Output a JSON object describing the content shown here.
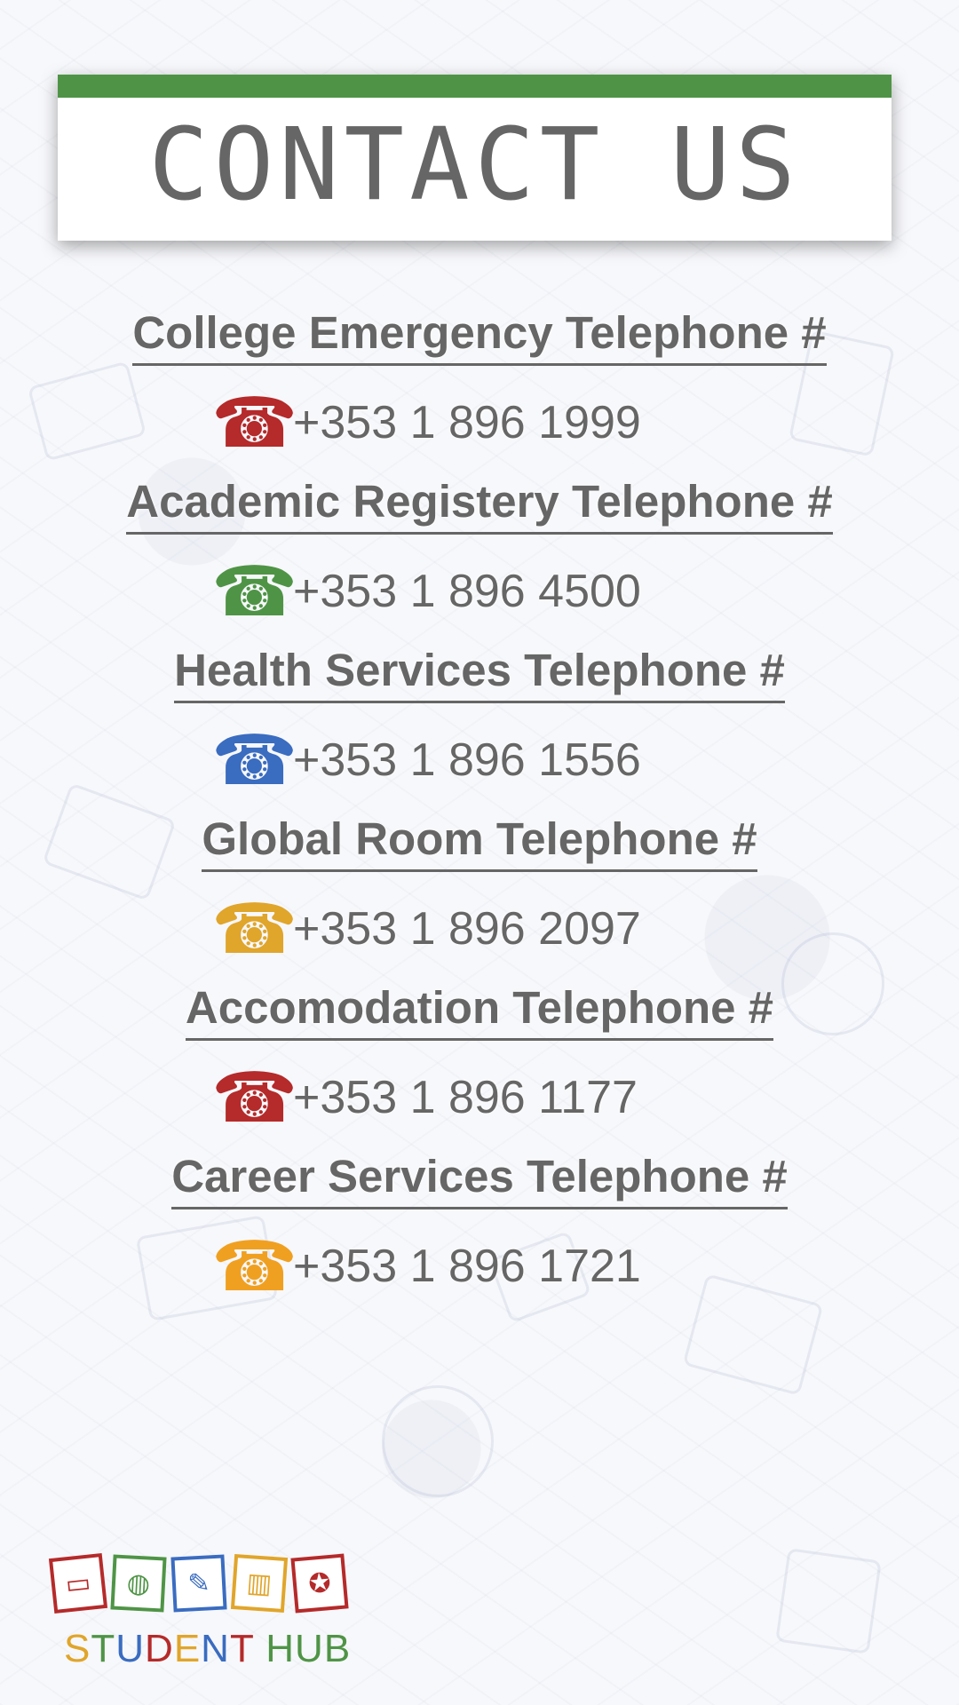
{
  "header": {
    "title": "CONTACT US",
    "accent": "#4f9446"
  },
  "contacts": [
    {
      "title": "College Emergency Telephone #",
      "number": "+353 1 896 1999",
      "icon": "phone-icon",
      "icon_color": "#b52a2a"
    },
    {
      "title": "Academic Registery Telephone #",
      "number": "+353 1 896 4500",
      "icon": "phone-icon",
      "icon_color": "#4f9446"
    },
    {
      "title": "Health Services Telephone #",
      "number": "+353 1 896 1556",
      "icon": "phone-icon",
      "icon_color": "#3a6cc0"
    },
    {
      "title": "Global Room Telephone #",
      "number": "+353 1 896 2097",
      "icon": "phone-icon",
      "icon_color": "#e0a52b"
    },
    {
      "title": "Accomodation Telephone #",
      "number": "+353 1 896 1177",
      "icon": "phone-icon",
      "icon_color": "#b52a2a"
    },
    {
      "title": "Career Services Telephone #",
      "number": "+353 1 896 1721",
      "icon": "phone-icon",
      "icon_color": "#f0a020"
    }
  ],
  "logo": {
    "tiles": [
      "laptop-icon",
      "globe-icon",
      "document-icon",
      "book-icon",
      "award-icon"
    ],
    "text_part_1": "STUDENT",
    "text_part_2": "HUB",
    "letter_colors": [
      "#e0a52b",
      "#4f9446",
      "#3a6cc0",
      "#b52a2a",
      "#e0a52b",
      "#3a6cc0",
      "#b52a2a"
    ],
    "hub_color": "#4f9446"
  }
}
